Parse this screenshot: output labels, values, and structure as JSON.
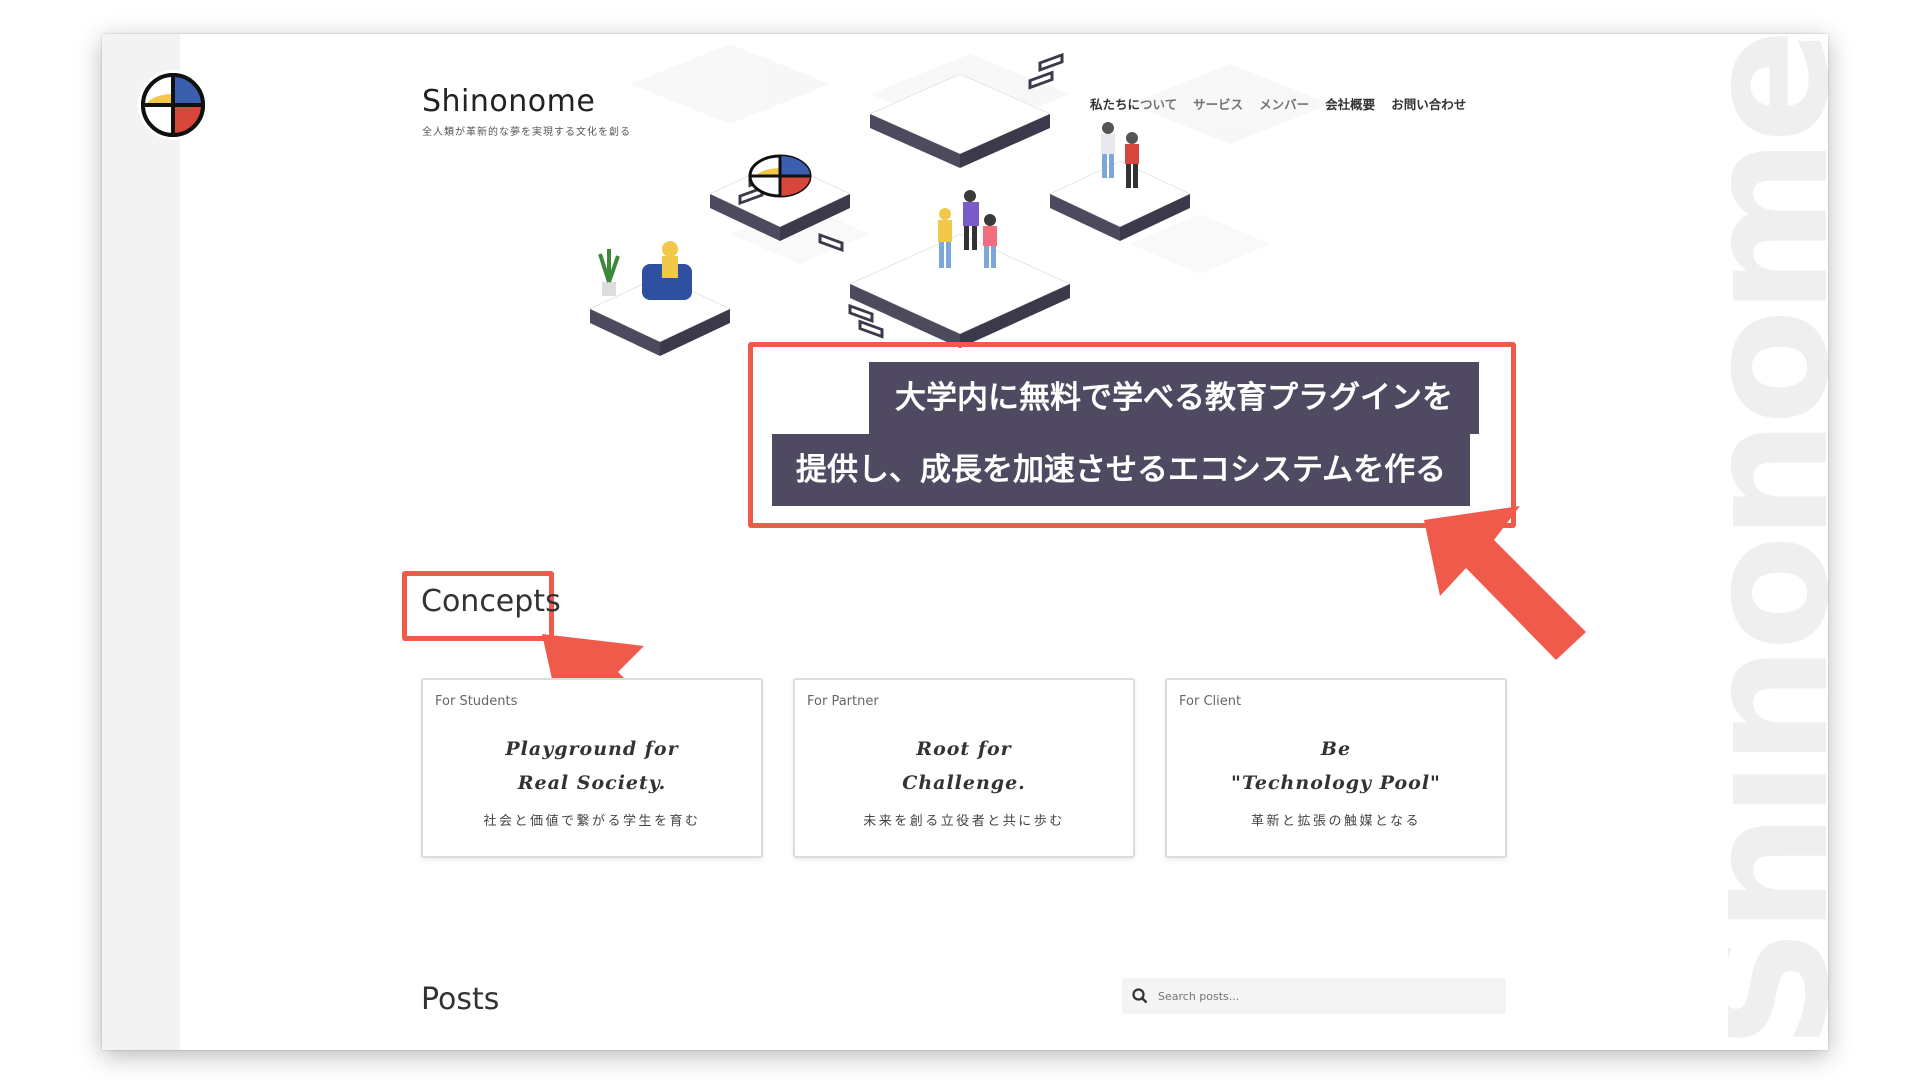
{
  "brand": {
    "name": "Shinonome",
    "tagline": "全人類が革新的な夢を実現する文化を創る"
  },
  "watermark": "Shinonome",
  "nav": [
    {
      "label": "私たちについて"
    },
    {
      "label": "サービス"
    },
    {
      "label": "メンバー"
    },
    {
      "label": "会社概要"
    },
    {
      "label": "お問い合わせ"
    }
  ],
  "hero": {
    "line1": "大学内に無料で学べる教育プラグインを",
    "line2": "提供し、成長を加速させるエコシステムを作る"
  },
  "concepts": {
    "title": "Concepts",
    "cards": [
      {
        "label": "For Students",
        "motto": "Playground for\nReal Society.",
        "sub": "社会と価値で繋がる学生を育む"
      },
      {
        "label": "For Partner",
        "motto": "Root for\nChallenge.",
        "sub": "未来を創る立役者と共に歩む"
      },
      {
        "label": "For Client",
        "motto": "Be\n\"Technology Pool\"",
        "sub": "革新と拡張の触媒となる"
      }
    ]
  },
  "posts": {
    "title": "Posts",
    "search_placeholder": "Search posts..."
  },
  "colors": {
    "accent_red": "#f05a4b",
    "hero_bg": "#4f4a62",
    "logo_blue": "#3b5fae",
    "logo_yellow": "#f2c84b",
    "logo_red": "#d9463b"
  },
  "icons": [
    "shinonome-logo-icon",
    "search-icon",
    "arrow-annotation-icon"
  ]
}
